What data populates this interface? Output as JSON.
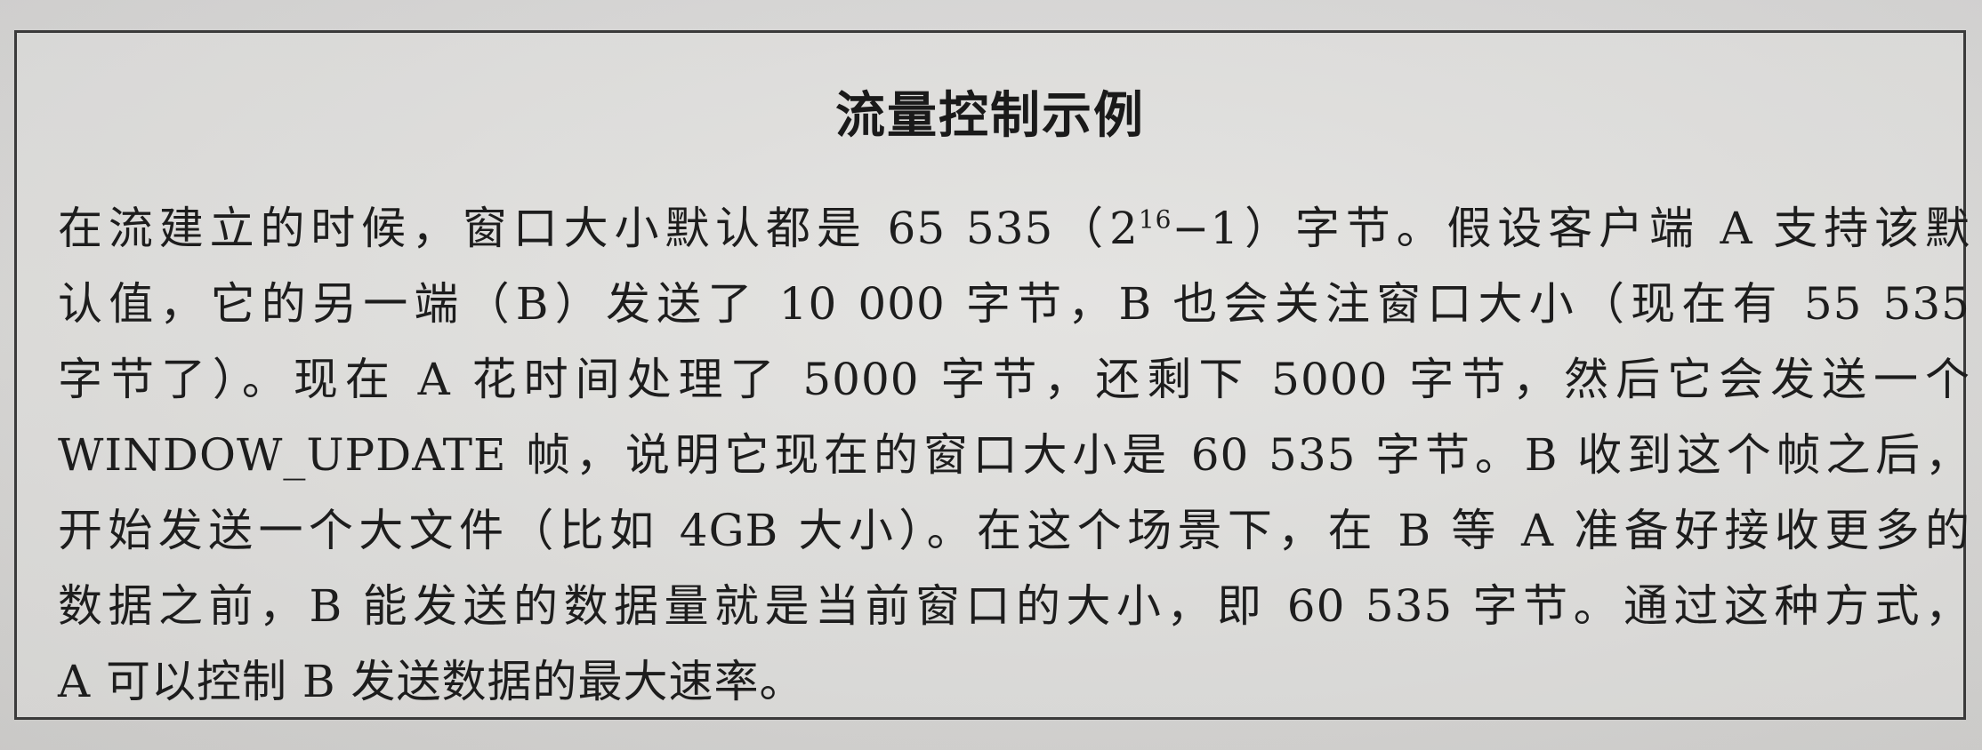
{
  "title": "流量控制示例",
  "lines": [
    {
      "pre": "在流建立的时候，窗口大小默认都是 65 535（2",
      "sup": "16",
      "post": "−1）字节。假设客户端 A 支持该默"
    },
    {
      "text": "认值，它的另一端（B）发送了 10 000 字节，B 也会关注窗口大小（现在有 55 535"
    },
    {
      "text": "字节了）。现在 A 花时间处理了 5000 字节，还剩下 5000 字节，然后它会发送一个"
    },
    {
      "text": "WINDOW_UPDATE 帧，说明它现在的窗口大小是 60 535 字节。B 收到这个帧之后，"
    },
    {
      "text": "开始发送一个大文件（比如 4GB 大小）。在这个场景下，在 B 等 A 准备好接收更多的"
    },
    {
      "text": "数据之前，B 能发送的数据量就是当前窗口的大小，即 60 535 字节。通过这种方式，"
    },
    {
      "text": "A 可以控制 B 发送数据的最大速率。"
    }
  ]
}
